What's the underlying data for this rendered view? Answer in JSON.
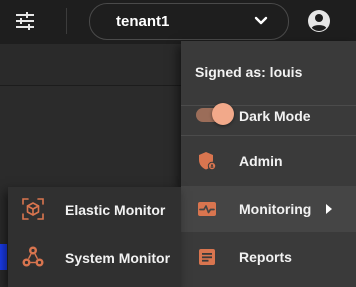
{
  "header": {
    "tenant_selected": "tenant1",
    "filter_icon": "tune-sliders-icon",
    "account_icon": "account-circle-icon",
    "chevron_icon": "chevron-down-icon"
  },
  "user_menu": {
    "signed_as": "Signed as: louis",
    "dark_mode": {
      "label": "Dark Mode",
      "enabled": true
    },
    "items": [
      {
        "label": "Admin",
        "icon": "admin-shield-icon"
      },
      {
        "label": "Monitoring",
        "icon": "monitoring-pulse-icon",
        "has_submenu": true
      },
      {
        "label": "Reports",
        "icon": "reports-document-icon"
      }
    ]
  },
  "monitoring_submenu": {
    "items": [
      {
        "label": "Elastic Monitor",
        "icon": "elastic-cube-icon"
      },
      {
        "label": "System Monitor",
        "icon": "system-cluster-icon"
      }
    ]
  },
  "colors": {
    "accent": "#d9754f",
    "toggle_knob": "#f2a98a",
    "toggle_track": "#9b6d59",
    "menu_bg": "#3a3a3a",
    "submenu_bg": "#303030",
    "topbar_bg": "#1e1e1e",
    "edge_chip": "#1a3cf0"
  }
}
